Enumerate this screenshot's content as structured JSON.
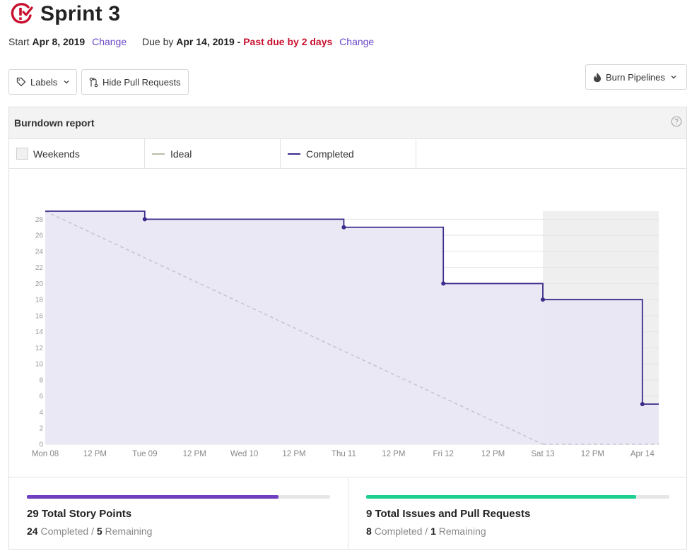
{
  "sprint": {
    "title": "Sprint 3",
    "start_label": "Start",
    "start_date": "Apr 8, 2019",
    "change_label": "Change",
    "due_label": "Due by",
    "due_date": "Apr 14, 2019",
    "separator": "-",
    "past_due": "Past due by 2 days",
    "change_label_2": "Change"
  },
  "toolbar": {
    "labels_button": "Labels",
    "hide_pr_button": "Hide Pull Requests",
    "burn_button": "Burn Pipelines"
  },
  "report": {
    "title": "Burndown report",
    "legend": {
      "weekends": "Weekends",
      "ideal": "Ideal",
      "completed": "Completed"
    }
  },
  "colors": {
    "accent": "#6a47c7",
    "completed_line": "#3d2a8a",
    "completed_fill": "#e9e6f4",
    "ideal_line": "#c8c4d4",
    "weekend_shade": "#efefef",
    "past_due": "#c8102e",
    "issues_bar": "#1ed08f",
    "points_bar": "#6e3fbf"
  },
  "chart_data": {
    "type": "line",
    "x_ticks": [
      "Mon 08",
      "12 PM",
      "Tue 09",
      "12 PM",
      "Wed 10",
      "12 PM",
      "Thu 11",
      "12 PM",
      "Fri 12",
      "12 PM",
      "Sat 13",
      "12 PM",
      "Apr 14"
    ],
    "y_ticks": [
      0,
      2,
      4,
      6,
      8,
      10,
      12,
      14,
      16,
      18,
      20,
      22,
      24,
      26,
      28
    ],
    "ylim": [
      0,
      29
    ],
    "weekend_range": [
      "Sat 13",
      "Apr 14"
    ],
    "series": [
      {
        "name": "Completed",
        "step": true,
        "points": [
          {
            "x": "Mon 08",
            "y": 29
          },
          {
            "x": "Tue 09",
            "y": 28
          },
          {
            "x": "Thu 11",
            "y": 27
          },
          {
            "x": "Fri 12",
            "y": 20
          },
          {
            "x": "Sat 13",
            "y": 18
          },
          {
            "x": "Apr 14",
            "y": 5
          }
        ]
      },
      {
        "name": "Ideal",
        "points": [
          {
            "x": "Mon 08",
            "y": 29
          },
          {
            "x": "Sat 13",
            "y": 0
          }
        ]
      }
    ]
  },
  "stats": {
    "story_points": {
      "heading": "29 Total Story Points",
      "completed_value": "24",
      "completed_label": "Completed",
      "slash": "/",
      "remaining_value": "5",
      "remaining_label": "Remaining",
      "progress": 0.83
    },
    "issues": {
      "heading": "9 Total Issues and Pull Requests",
      "completed_value": "8",
      "completed_label": "Completed",
      "slash": "/",
      "remaining_value": "1",
      "remaining_label": "Remaining",
      "progress": 0.89
    }
  }
}
